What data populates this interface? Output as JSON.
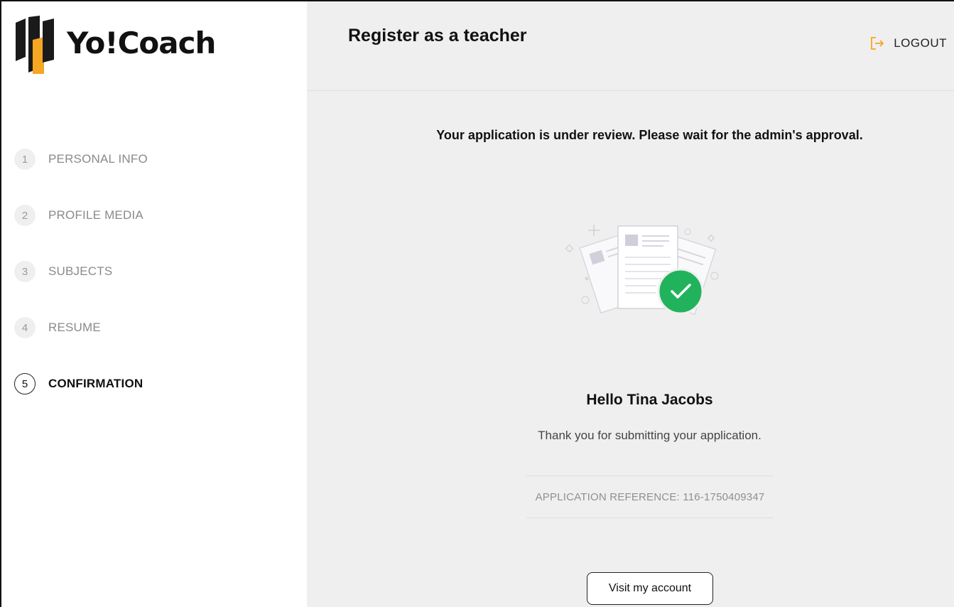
{
  "brand": {
    "name": "Yo!Coach"
  },
  "header": {
    "title": "Register as a teacher",
    "logout_label": "LOGOUT"
  },
  "steps": [
    {
      "num": "1",
      "label": "PERSONAL INFO"
    },
    {
      "num": "2",
      "label": "PROFILE MEDIA"
    },
    {
      "num": "3",
      "label": "SUBJECTS"
    },
    {
      "num": "4",
      "label": "RESUME"
    },
    {
      "num": "5",
      "label": "CONFIRMATION"
    }
  ],
  "active_step": "5",
  "confirmation": {
    "review_message": "Your application is under review. Please wait for the admin's approval.",
    "greeting": "Hello Tina Jacobs",
    "thanks": "Thank you for submitting your application.",
    "reference": "APPLICATION REFERENCE: 116-1750409347",
    "visit_button": "Visit my account"
  },
  "colors": {
    "accent": "#f5a623",
    "success": "#21b35c",
    "main_bg": "#efefef"
  }
}
